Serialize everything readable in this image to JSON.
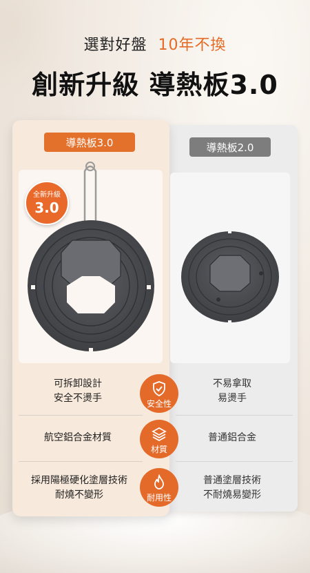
{
  "header": {
    "subtitle_main": "選對好盤",
    "subtitle_accent": "10年不換",
    "title": "創新升級 導熱板3.0"
  },
  "left_card": {
    "pill": "導熱板3.0",
    "badge_line1": "全新升級",
    "badge_line2": "3.0"
  },
  "right_card": {
    "pill": "導熱板2.0"
  },
  "features": [
    {
      "label": "安全性",
      "icon": "shield-check-icon",
      "left": [
        "可拆卸設計",
        "安全不燙手"
      ],
      "right": [
        "不易拿取",
        "易燙手"
      ]
    },
    {
      "label": "材質",
      "icon": "layers-icon",
      "left": [
        "航空鋁合金材質"
      ],
      "right": [
        "普通鋁合金"
      ]
    },
    {
      "label": "耐用性",
      "icon": "flame-icon",
      "left": [
        "採用陽極硬化塗層技術",
        "耐燒不變形"
      ],
      "right": [
        "普通塗層技術",
        "不耐燒易變形"
      ]
    }
  ],
  "colors": {
    "accent": "#e46b25",
    "grey_pill": "#7d7d7d",
    "plate": "#4a4c50"
  }
}
